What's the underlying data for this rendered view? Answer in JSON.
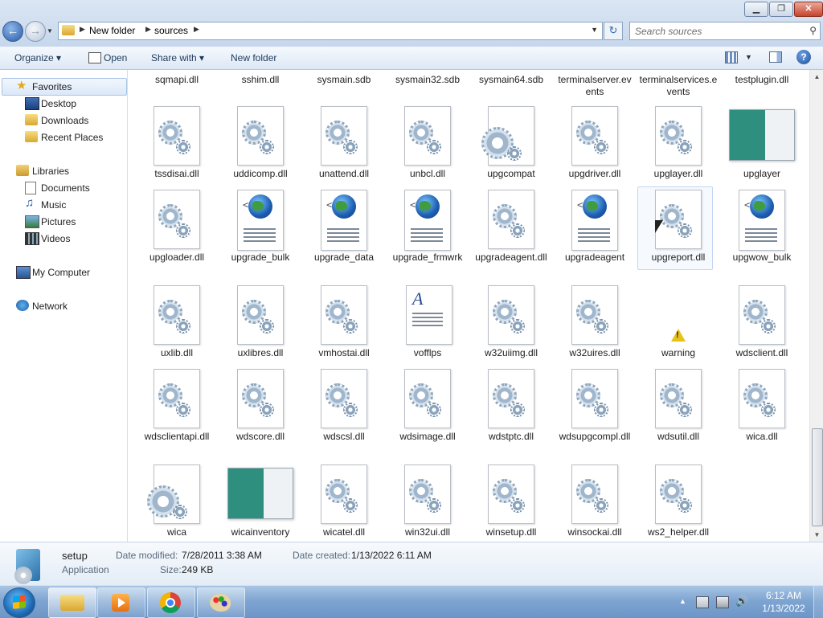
{
  "window": {
    "minimize_glyph": "▁",
    "maximize_glyph": "❐",
    "close_glyph": "✕"
  },
  "address": {
    "crumbs": [
      "New folder",
      "sources"
    ],
    "search_placeholder": "Search sources"
  },
  "toolbar": {
    "organize": "Organize",
    "open": "Open",
    "share_with": "Share with",
    "new_folder": "New folder"
  },
  "nav": {
    "favorites": "Favorites",
    "desktop": "Desktop",
    "downloads": "Downloads",
    "recent_places": "Recent Places",
    "libraries": "Libraries",
    "documents": "Documents",
    "music": "Music",
    "pictures": "Pictures",
    "videos": "Videos",
    "my_computer": "My Computer",
    "network": "Network"
  },
  "files": {
    "row0": [
      "sqmapi.dll",
      "sshim.dll",
      "sysmain.sdb",
      "sysmain32.sdb",
      "sysmain64.sdb",
      "terminalserver.events",
      "terminalservices.events",
      "testplugin.dll"
    ],
    "row1": [
      {
        "name": "tssdisai.dll",
        "icon": "gear-dll"
      },
      {
        "name": "uddicomp.dll",
        "icon": "gear-dll"
      },
      {
        "name": "unattend.dll",
        "icon": "gear-dll"
      },
      {
        "name": "unbcl.dll",
        "icon": "gear-dll"
      },
      {
        "name": "upgcompat",
        "icon": "gear-app"
      },
      {
        "name": "upgdriver.dll",
        "icon": "gear-dll"
      },
      {
        "name": "upglayer.dll",
        "icon": "gear-dll"
      },
      {
        "name": "upglayer",
        "icon": "window-thumb"
      }
    ],
    "row2": [
      {
        "name": "upgloader.dll",
        "icon": "gear-dll"
      },
      {
        "name": "upgrade_bulk",
        "icon": "web-doc"
      },
      {
        "name": "upgrade_data",
        "icon": "web-doc"
      },
      {
        "name": "upgrade_frmwrk",
        "icon": "web-doc"
      },
      {
        "name": "upgradeagent.dll",
        "icon": "gear-dll"
      },
      {
        "name": "upgradeagent",
        "icon": "web-doc"
      },
      {
        "name": "upgreport.dll",
        "icon": "gear-dll"
      },
      {
        "name": "upgwow_bulk",
        "icon": "web-doc"
      }
    ],
    "row3": [
      {
        "name": "uxlib.dll",
        "icon": "gear-dll"
      },
      {
        "name": "uxlibres.dll",
        "icon": "gear-dll"
      },
      {
        "name": "vmhostai.dll",
        "icon": "gear-dll"
      },
      {
        "name": "vofflps",
        "icon": "rtf-doc"
      },
      {
        "name": "w32uiimg.dll",
        "icon": "gear-dll"
      },
      {
        "name": "w32uires.dll",
        "icon": "gear-dll"
      },
      {
        "name": "warning",
        "icon": "warning"
      },
      {
        "name": "wdsclient.dll",
        "icon": "gear-dll"
      }
    ],
    "row4": [
      {
        "name": "wdsclientapi.dll",
        "icon": "gear-dll"
      },
      {
        "name": "wdscore.dll",
        "icon": "gear-dll"
      },
      {
        "name": "wdscsl.dll",
        "icon": "gear-dll"
      },
      {
        "name": "wdsimage.dll",
        "icon": "gear-dll"
      },
      {
        "name": "wdstptc.dll",
        "icon": "gear-dll"
      },
      {
        "name": "wdsupgcompl.dll",
        "icon": "gear-dll"
      },
      {
        "name": "wdsutil.dll",
        "icon": "gear-dll"
      },
      {
        "name": "wica.dll",
        "icon": "gear-dll"
      }
    ],
    "row5": [
      {
        "name": "wica",
        "icon": "gear-app"
      },
      {
        "name": "wicainventory",
        "icon": "window-thumb"
      },
      {
        "name": "wicatel.dll",
        "icon": "gear-dll"
      },
      {
        "name": "win32ui.dll",
        "icon": "gear-dll"
      },
      {
        "name": "winsetup.dll",
        "icon": "gear-dll"
      },
      {
        "name": "winsockai.dll",
        "icon": "gear-dll"
      },
      {
        "name": "ws2_helper.dll",
        "icon": "gear-dll"
      }
    ]
  },
  "details": {
    "name": "setup",
    "type": "Application",
    "date_modified_label": "Date modified:",
    "date_modified": "7/28/2011 3:38 AM",
    "date_created_label": "Date created:",
    "date_created": "1/13/2022 6:11 AM",
    "size_label": "Size:",
    "size": "249 KB"
  },
  "taskbar": {
    "time": "6:12 AM",
    "date": "1/13/2022"
  },
  "colors": {
    "accent": "#2759a7",
    "selection": "#c2d7f0"
  }
}
